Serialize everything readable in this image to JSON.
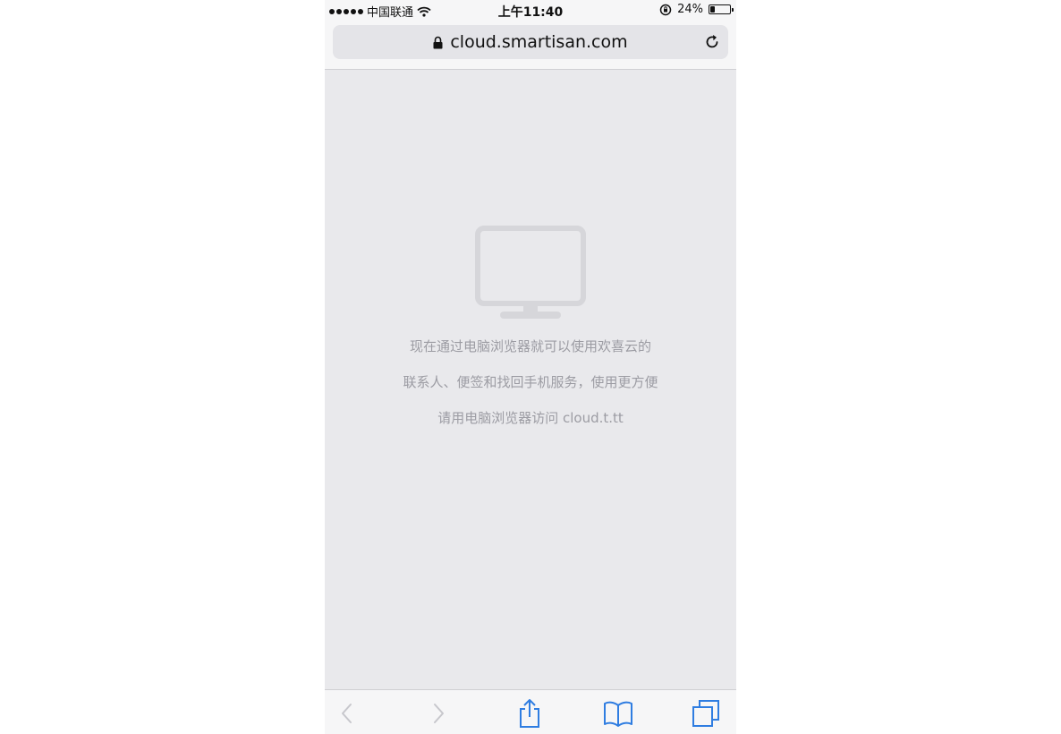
{
  "status_bar": {
    "carrier": "中国联通",
    "time": "上午11:40",
    "battery_percent": "24%",
    "battery_level": 0.24
  },
  "url_bar": {
    "url": "cloud.smartisan.com"
  },
  "message": {
    "line1": "现在通过电脑浏览器就可以使用欢喜云的",
    "line2": "联系人、便签和找回手机服务，使用更方便",
    "line3": "请用电脑浏览器访问 cloud.t.tt"
  },
  "icons": {
    "main": "monitor-icon",
    "toolbar": [
      "back-icon",
      "forward-icon",
      "share-icon",
      "bookmarks-icon",
      "tabs-icon"
    ]
  },
  "colors": {
    "content_bg": "#e9e9ec",
    "text_gray": "#9c9ca3",
    "icon_gray": "#d6d6da",
    "toolbar_blue": "#2f7de1",
    "toolbar_disabled": "#c7c7cc"
  }
}
